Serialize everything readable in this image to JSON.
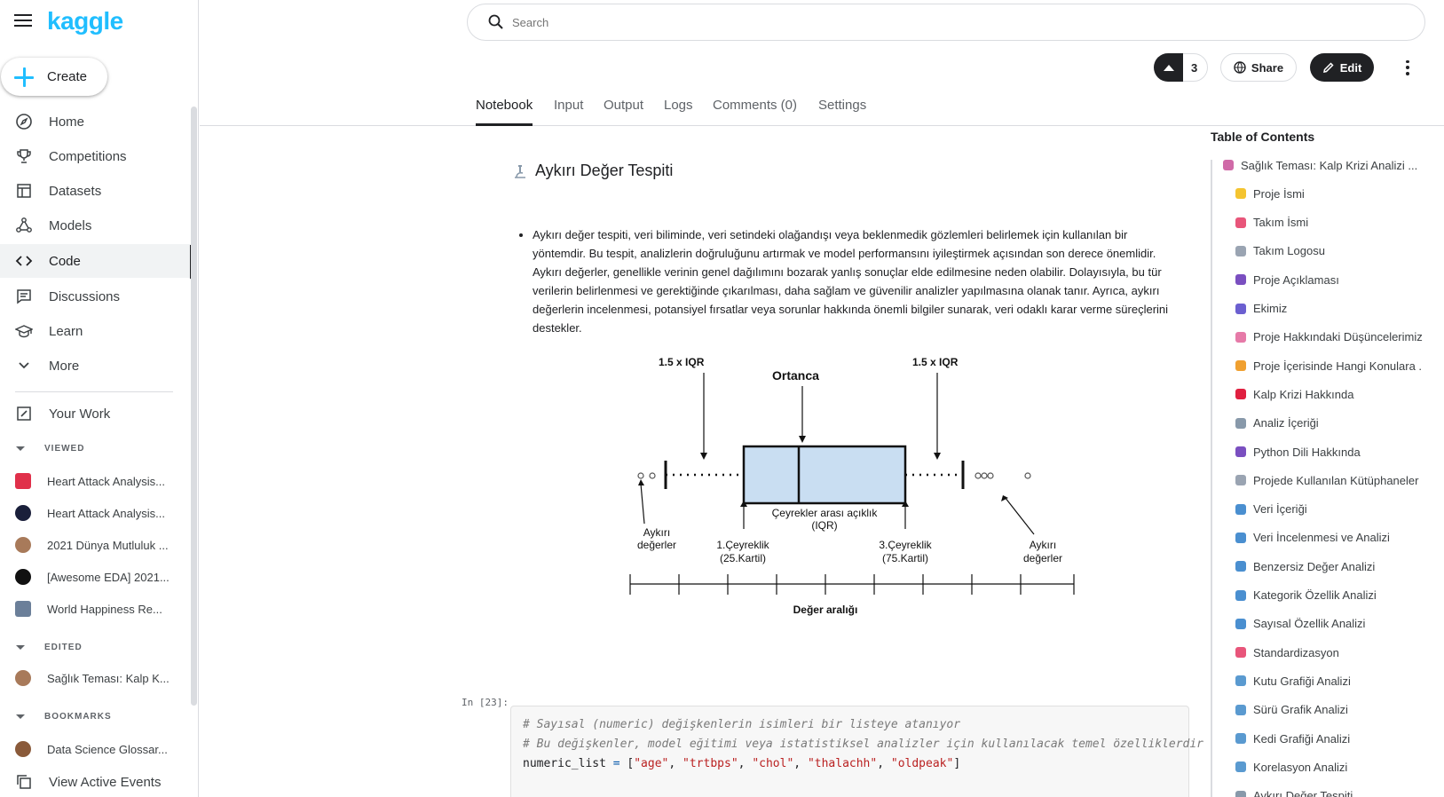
{
  "sidebar": {
    "logo": "kaggle",
    "create_label": "Create",
    "nav": [
      {
        "label": "Home",
        "icon": "compass-icon"
      },
      {
        "label": "Competitions",
        "icon": "trophy-icon"
      },
      {
        "label": "Datasets",
        "icon": "table-icon"
      },
      {
        "label": "Models",
        "icon": "models-icon"
      },
      {
        "label": "Code",
        "icon": "code-icon"
      },
      {
        "label": "Discussions",
        "icon": "discussion-icon"
      },
      {
        "label": "Learn",
        "icon": "graduation-cap-icon"
      },
      {
        "label": "More",
        "icon": "chevron-down-icon"
      }
    ],
    "your_work": "Your Work",
    "viewed_label": "VIEWED",
    "viewed": [
      {
        "label": "Heart Attack Analysis...",
        "color": "#e0304a"
      },
      {
        "label": "Heart Attack Analysis...",
        "color": "#1a1f3a"
      },
      {
        "label": "2021 Dünya Mutluluk ...",
        "color": "#a87a5a"
      },
      {
        "label": "[Awesome EDA] 2021...",
        "color": "#111111"
      },
      {
        "label": "World Happiness Re...",
        "color": "#6b7f99"
      }
    ],
    "edited_label": "EDITED",
    "edited": [
      {
        "label": "Sağlık Teması: Kalp K...",
        "color": "#a87a5a"
      }
    ],
    "bookmarks_label": "BOOKMARKS",
    "bookmarks": [
      {
        "label": "Data Science Glossar...",
        "color": "#8a5a3a"
      }
    ],
    "view_events": "View Active Events"
  },
  "search": {
    "placeholder": "Search"
  },
  "actions": {
    "vote_count": "3",
    "share": "Share",
    "edit": "Edit"
  },
  "tabs": [
    "Notebook",
    "Input",
    "Output",
    "Logs",
    "Comments (0)",
    "Settings"
  ],
  "content": {
    "heading": "Aykırı Değer Tespiti",
    "paragraph": "Aykırı değer tespiti, veri biliminde, veri setindeki olağandışı veya beklenmedik gözlemleri belirlemek için kullanılan bir yöntemdir. Bu tespit, analizlerin doğruluğunu artırmak ve model performansını iyileştirmek açısından son derece önemlidir. Aykırı değerler, genellikle verinin genel dağılımını bozarak yanlış sonuçlar elde edilmesine neden olabilir. Dolayısıyla, bu tür verilerin belirlenmesi ve gerektiğinde çıkarılması, daha sağlam ve güvenilir analizler yapılmasına olanak tanır. Ayrıca, aykırı değerlerin incelenmesi, potansiyel fırsatlar veya sorunlar hakkında önemli bilgiler sunarak, veri odaklı karar verme süreçlerini destekler.",
    "diagram": {
      "iqr_left": "1.5 x IQR",
      "median": "Ortanca",
      "iqr_right": "1.5 x IQR",
      "iqr_label1": "Çeyrekler arası açıklık",
      "iqr_label2": "(IQR)",
      "outlier_left1": "Aykırı",
      "outlier_left2": "değerler",
      "q1_1": "1.Çeyreklik",
      "q1_2": "(25.Kartil)",
      "q3_1": "3.Çeyreklik",
      "q3_2": "(75.Kartil)",
      "outlier_right1": "Aykırı",
      "outlier_right2": "değerler",
      "axis": "Değer aralığı"
    },
    "cell_prompt": "In [23]:",
    "code_comment1": "# Sayısal (numeric) değişkenlerin isimleri bir listeye atanıyor",
    "code_comment2": "# Bu değişkenler, model eğitimi veya istatistiksel analizler için kullanılacak temel özelliklerdir",
    "code_var": "numeric_list",
    "code_items": [
      "\"age\"",
      "\"trtbps\"",
      "\"chol\"",
      "\"thalachh\"",
      "\"oldpeak\""
    ]
  },
  "toc": {
    "title": "Table of Contents",
    "items": [
      {
        "label": "Sağlık Teması: Kalp Krizi Analizi ...",
        "color": "#d06aa8",
        "indent": false
      },
      {
        "label": "Proje İsmi",
        "color": "#f4c430",
        "indent": true
      },
      {
        "label": "Takım İsmi",
        "color": "#e8557a",
        "indent": true
      },
      {
        "label": "Takım Logosu",
        "color": "#9aa4b2",
        "indent": true
      },
      {
        "label": "Proje Açıklaması",
        "color": "#7a4fc0",
        "indent": true
      },
      {
        "label": "Ekimiz",
        "color": "#6b5fd0",
        "indent": true
      },
      {
        "label": "Proje Hakkındaki Düşüncelerimiz",
        "color": "#e67aa8",
        "indent": true
      },
      {
        "label": "Proje İçerisinde Hangi Konulara .",
        "color": "#f0a030",
        "indent": true
      },
      {
        "label": "Kalp Krizi Hakkında",
        "color": "#e02040",
        "indent": true
      },
      {
        "label": "Analiz İçeriği",
        "color": "#8899aa",
        "indent": true
      },
      {
        "label": "Python Dili Hakkında",
        "color": "#7a4fc0",
        "indent": true
      },
      {
        "label": "Projede Kullanılan Kütüphaneler",
        "color": "#9aa4b2",
        "indent": true
      },
      {
        "label": "Veri İçeriği",
        "color": "#4a8fd0",
        "indent": true
      },
      {
        "label": "Veri İncelenmesi ve Analizi",
        "color": "#4a8fd0",
        "indent": true
      },
      {
        "label": "Benzersiz Değer Analizi",
        "color": "#4a8fd0",
        "indent": true
      },
      {
        "label": "Kategorik Özellik Analizi",
        "color": "#4a8fd0",
        "indent": true
      },
      {
        "label": "Sayısal Özellik Analizi",
        "color": "#4a8fd0",
        "indent": true
      },
      {
        "label": "Standardizasyon",
        "color": "#e8557a",
        "indent": true
      },
      {
        "label": "Kutu Grafiği Analizi",
        "color": "#5a9ad0",
        "indent": true
      },
      {
        "label": "Sürü Grafik Analizi",
        "color": "#5a9ad0",
        "indent": true
      },
      {
        "label": "Kedi Grafiği Analizi",
        "color": "#5a9ad0",
        "indent": true
      },
      {
        "label": "Korelasyon Analizi",
        "color": "#5a9ad0",
        "indent": true
      },
      {
        "label": "Aykırı Değer Tespiti",
        "color": "#8899aa",
        "indent": true
      }
    ]
  }
}
